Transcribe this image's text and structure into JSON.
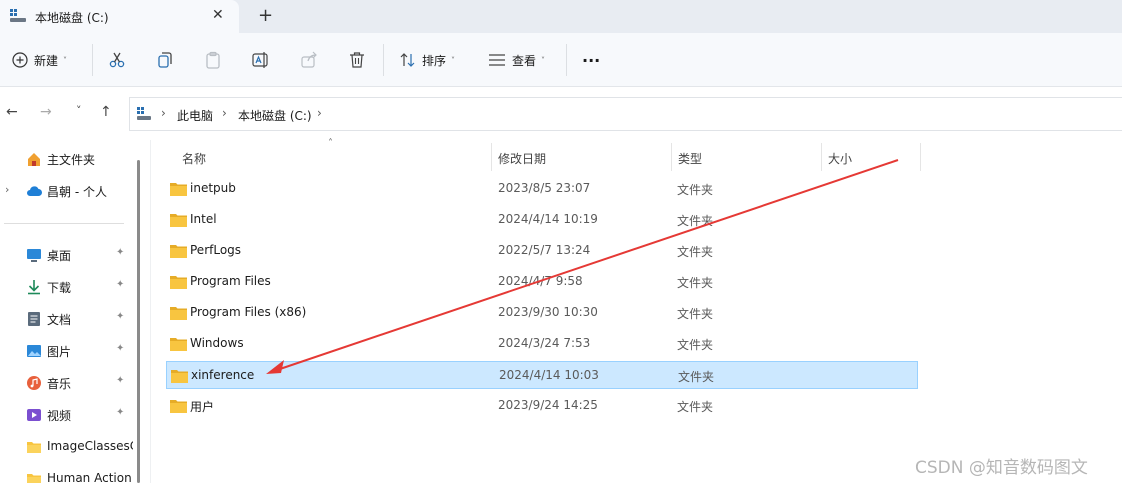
{
  "tab": {
    "title": "本地磁盘 (C:)",
    "close_glyph": "✕",
    "new_tab_glyph": "+"
  },
  "toolbar": {
    "new_label": "新建",
    "sort_label": "排序",
    "view_label": "查看",
    "more_glyph": "···",
    "chevron": "˅"
  },
  "nav": {
    "back": "←",
    "forward": "→",
    "recent": "˅",
    "up": "↑"
  },
  "breadcrumb": {
    "items": [
      "此电脑",
      "本地磁盘 (C:)"
    ],
    "sep": "›"
  },
  "sidebar": {
    "expand_glyph": "›",
    "pin_glyph": "📌",
    "top": [
      {
        "label": "主文件夹",
        "icon": "home-icon"
      },
      {
        "label": "昌朝 - 个人",
        "icon": "cloud-icon"
      }
    ],
    "pinned": [
      {
        "label": "桌面",
        "icon": "desktop-icon",
        "color": "#2b88d8"
      },
      {
        "label": "下载",
        "icon": "download-icon",
        "color": "#1e8a5a"
      },
      {
        "label": "文档",
        "icon": "document-icon",
        "color": "#5b6b7c"
      },
      {
        "label": "图片",
        "icon": "picture-icon",
        "color": "#2b88d8"
      },
      {
        "label": "音乐",
        "icon": "music-icon",
        "color": "#e8603c"
      },
      {
        "label": "视频",
        "icon": "video-icon",
        "color": "#7b4fd0"
      }
    ],
    "folders": [
      {
        "label": "ImageClassesC"
      },
      {
        "label": "Human Action"
      }
    ]
  },
  "columns": {
    "name": "名称",
    "modified": "修改日期",
    "type": "类型",
    "size": "大小",
    "sort_glyph": "˄"
  },
  "files": [
    {
      "name": "inetpub",
      "modified": "2023/8/5 23:07",
      "type": "文件夹",
      "selected": false
    },
    {
      "name": "Intel",
      "modified": "2024/4/14 10:19",
      "type": "文件夹",
      "selected": false
    },
    {
      "name": "PerfLogs",
      "modified": "2022/5/7 13:24",
      "type": "文件夹",
      "selected": false
    },
    {
      "name": "Program Files",
      "modified": "2024/4/7 9:58",
      "type": "文件夹",
      "selected": false
    },
    {
      "name": "Program Files (x86)",
      "modified": "2023/9/30 10:30",
      "type": "文件夹",
      "selected": false
    },
    {
      "name": "Windows",
      "modified": "2024/3/24 7:53",
      "type": "文件夹",
      "selected": false
    },
    {
      "name": "xinference",
      "modified": "2024/4/14 10:03",
      "type": "文件夹",
      "selected": true
    },
    {
      "name": "用户",
      "modified": "2023/9/24 14:25",
      "type": "文件夹",
      "selected": false
    }
  ],
  "watermark": "CSDN @知音数码图文",
  "colors": {
    "selection": "#cce8ff",
    "folder": "#f8c540",
    "annotation_arrow": "#e53935"
  }
}
